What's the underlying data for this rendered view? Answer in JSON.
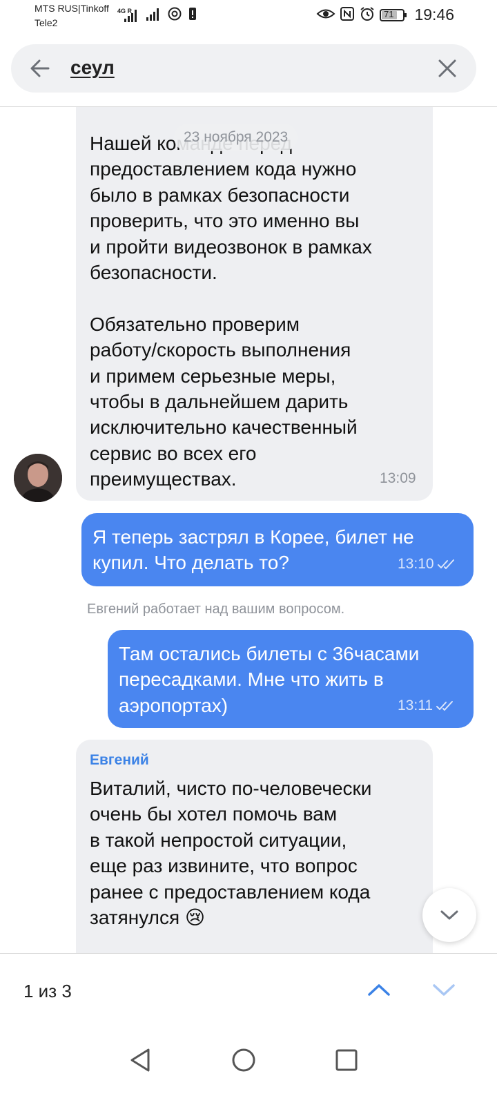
{
  "status_bar": {
    "carrier_1": "MTS RUS|Tinkoff",
    "carrier_2": "Tele2",
    "network_type": "4G R",
    "battery": "71",
    "time": "19:46"
  },
  "search": {
    "query": "сеул"
  },
  "chat": {
    "date_separator": "23 ноября 2023",
    "messages": [
      {
        "direction": "incoming",
        "text": "Нашей команде перед\nпредоставлением кода нужно\nбыло в рамках безопасности\nпроверить, что это именно вы\nи пройти видеозвонок в рамках\nбезопасности.\n\nОбязательно проверим\nработу/скорость выполнения\nи примем серьезные меры,\nчтобы в дальнейшем дарить\nисключительно качественный\nсервис во всех его\nпреимуществах.",
        "time": "13:09"
      },
      {
        "direction": "outgoing",
        "text": "Я теперь застрял в Корее, билет не\nкупил. Что делать то?",
        "time": "13:10"
      },
      {
        "direction": "system",
        "text": "Евгений работает над вашим вопросом."
      },
      {
        "direction": "outgoing",
        "text": "Там остались билеты с 36часами\nпересадками. Мне что жить в\nаэропортах)",
        "time": "13:11"
      },
      {
        "direction": "incoming",
        "sender": "Евгений",
        "text": "Виталий, чисто по-человечески\nочень бы хотел помочь вам\nв такой непростой ситуации,\nеще раз извините, что вопрос\nранее с предоставлением кода\nзатянулся 😢"
      }
    ]
  },
  "search_nav": {
    "result_count": "1 из 3"
  },
  "colors": {
    "outgoing_bubble": "#4a86f0",
    "incoming_bubble": "#eeeff2",
    "accent": "#3b82e6"
  }
}
